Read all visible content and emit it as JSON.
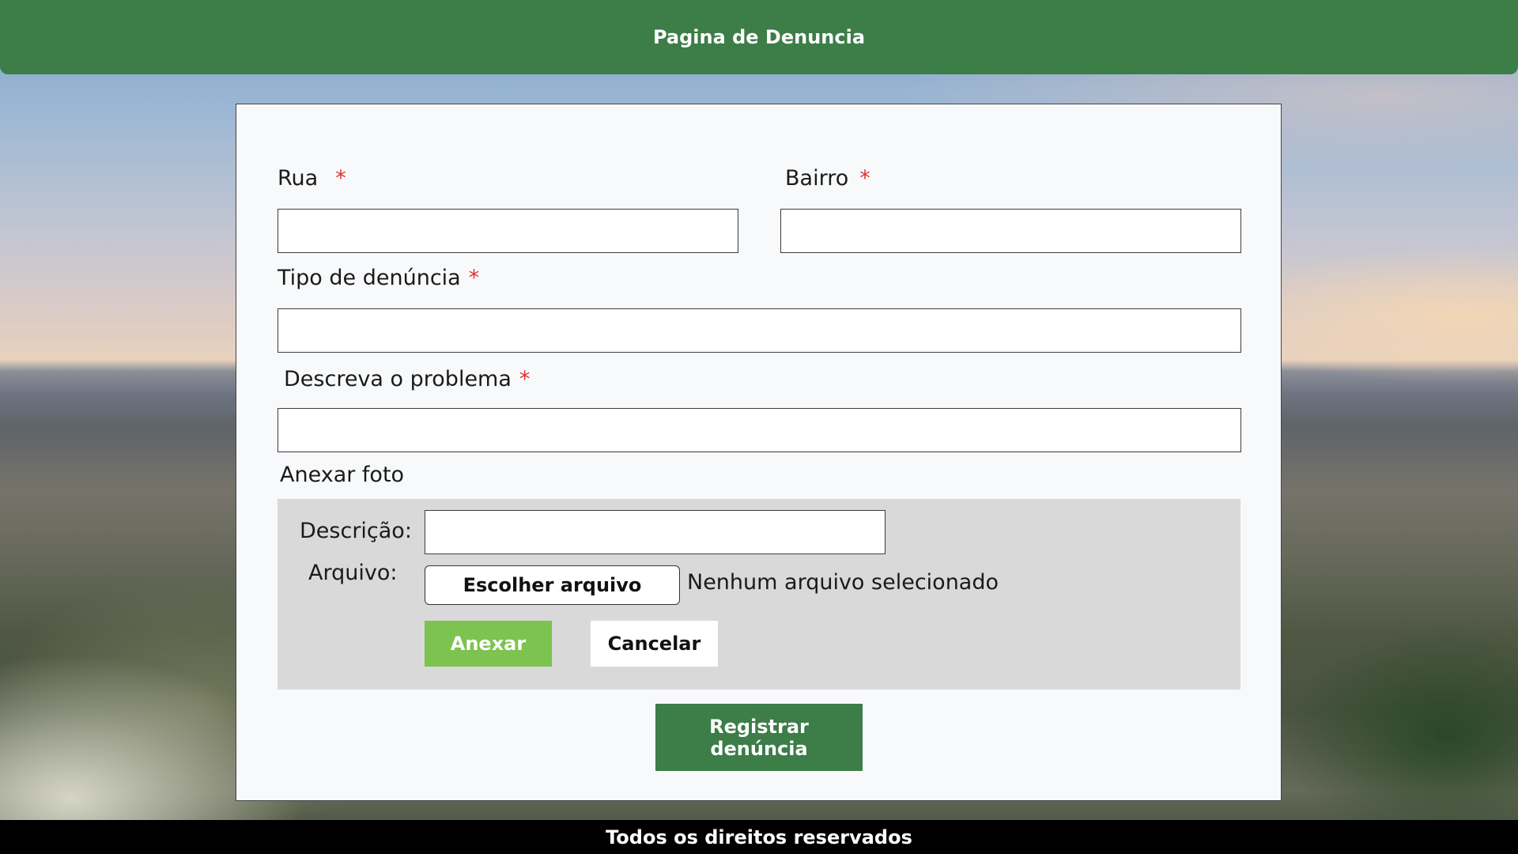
{
  "header": {
    "title": "Pagina de Denuncia"
  },
  "form": {
    "rua": {
      "label": "Rua",
      "required_mark": "*",
      "value": ""
    },
    "bairro": {
      "label": "Bairro",
      "required_mark": "*",
      "value": ""
    },
    "tipo": {
      "label": "Tipo de denúncia",
      "required_mark": "*",
      "value": ""
    },
    "descricao_problema": {
      "label": "Descreva o problema",
      "required_mark": "*",
      "value": ""
    },
    "anexar_foto": {
      "section_label": "Anexar foto",
      "descricao_label": "Descrição:",
      "descricao_value": "",
      "arquivo_label": "Arquivo:",
      "choose_file_label": "Escolher arquivo",
      "file_status": "Nenhum arquivo selecionado",
      "anexar_label": "Anexar",
      "cancelar_label": "Cancelar"
    },
    "submit_label": "Registrar denúncia"
  },
  "footer": {
    "text": "Todos os direitos reservados"
  },
  "colors": {
    "header_green": "#3c7d48",
    "anexar_green": "#7cc34f",
    "required_red": "#e0322f",
    "attach_box_gray": "#d9d9d9",
    "panel_bg": "#f8f9fb",
    "footer_bg": "#000000"
  }
}
